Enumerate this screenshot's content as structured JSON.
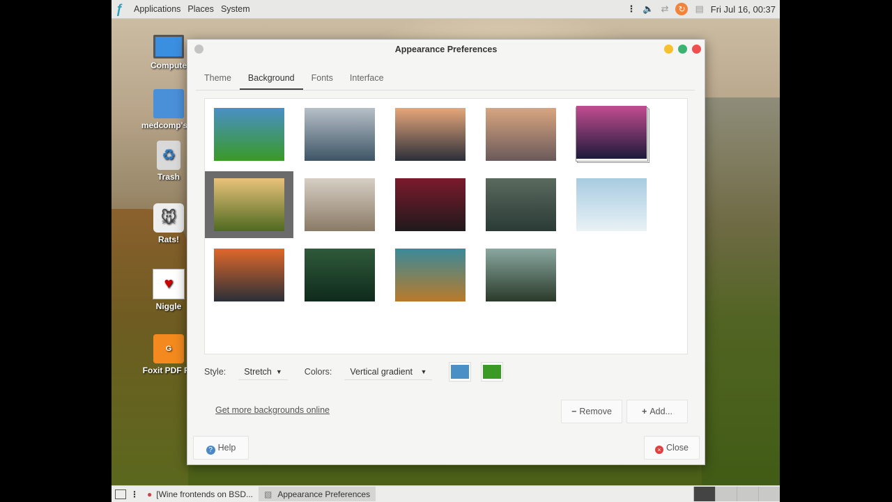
{
  "top_panel": {
    "menus": [
      "Applications",
      "Places",
      "System"
    ],
    "clock": "Fri Jul 16, 00:37"
  },
  "desktop_icons": [
    "Compute",
    "medcomp's H",
    "Trash",
    "Rats!",
    "Niggle",
    "Foxit PDF Re"
  ],
  "dialog": {
    "title": "Appearance Preferences",
    "tabs": [
      "Theme",
      "Background",
      "Fonts",
      "Interface"
    ],
    "active_tab": "Background",
    "style_label": "Style:",
    "style_value": "Stretch",
    "colors_label": "Colors:",
    "colors_value": "Vertical gradient",
    "color1": "#4a8fc6",
    "color2": "#3a9a25",
    "link": "Get more backgrounds online",
    "remove": "Remove",
    "add": "Add...",
    "help": "Help",
    "close": "Close"
  },
  "wallpapers": [
    {
      "name": "gradient",
      "colors": [
        "#4a8fc6",
        "#3a9a25"
      ]
    },
    {
      "name": "mountain lake",
      "colors": [
        "#b7c0c8",
        "#3e5566"
      ]
    },
    {
      "name": "desert buttes",
      "colors": [
        "#e7a77a",
        "#2b2f3a"
      ]
    },
    {
      "name": "river town",
      "colors": [
        "#d9a580",
        "#6a5a5a"
      ]
    },
    {
      "name": "nebula",
      "colors": [
        "#c24d8f",
        "#1d1a3b"
      ]
    },
    {
      "name": "valley sunrise",
      "colors": [
        "#e9c27a",
        "#4f6a20"
      ]
    },
    {
      "name": "frost branches",
      "colors": [
        "#d7cfc4",
        "#8a7a66"
      ]
    },
    {
      "name": "red leaves",
      "colors": [
        "#7b1a2c",
        "#1f1a1c"
      ]
    },
    {
      "name": "stone path",
      "colors": [
        "#5a6a5e",
        "#2a3a36"
      ]
    },
    {
      "name": "snow road",
      "colors": [
        "#a8cbe0",
        "#e9f2f6"
      ]
    },
    {
      "name": "forest fire",
      "colors": [
        "#e0682a",
        "#2a2f38"
      ]
    },
    {
      "name": "green forest",
      "colors": [
        "#2f5a3a",
        "#0f2a1c"
      ]
    },
    {
      "name": "autumn lake",
      "colors": [
        "#3a8a9a",
        "#b97a2a"
      ]
    },
    {
      "name": "valley mist",
      "colors": [
        "#8aa8a0",
        "#2a3a2a"
      ]
    }
  ],
  "taskbar": {
    "tasks": [
      "[Wine frontends on BSD...",
      "Appearance Preferences"
    ],
    "active_task": "Appearance Preferences"
  }
}
